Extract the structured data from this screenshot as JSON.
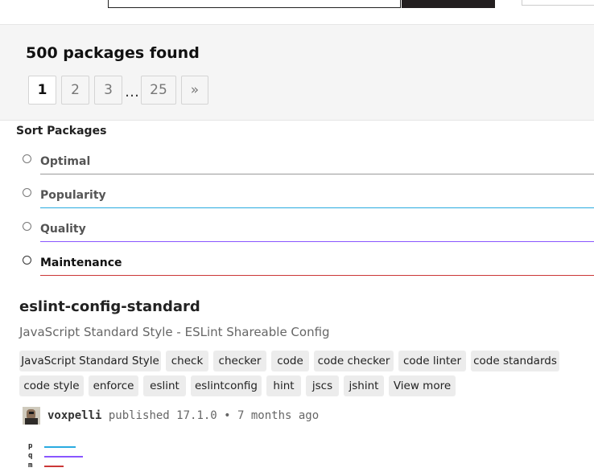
{
  "results": {
    "count_text": "500 packages found"
  },
  "pagination": {
    "pages": [
      "1",
      "2",
      "3",
      "25"
    ],
    "ellipsis": "…",
    "next": "»",
    "current": "1"
  },
  "sort": {
    "title": "Sort Packages",
    "options": [
      {
        "label": "Optimal",
        "color": "#999999",
        "selected": false
      },
      {
        "label": "Popularity",
        "color": "#29abe0",
        "selected": false
      },
      {
        "label": "Quality",
        "color": "#8956ff",
        "selected": false
      },
      {
        "label": "Maintenance",
        "color": "#cb3837",
        "selected": true
      }
    ]
  },
  "package": {
    "name": "eslint-config-standard",
    "description": "JavaScript Standard Style - ESLint Shareable Config",
    "keywords": [
      "JavaScript Standard Style",
      "check",
      "checker",
      "code",
      "code checker",
      "code linter",
      "code standards",
      "code style",
      "enforce",
      "eslint",
      "eslintconfig",
      "hint",
      "jscs",
      "jshint"
    ],
    "view_more": "View more",
    "publisher": "voxpelli",
    "published_text": "published 17.1.0 • 7 months ago",
    "scores": [
      {
        "letter": "p",
        "value": 0.39,
        "color": "#29abe0"
      },
      {
        "letter": "q",
        "value": 0.48,
        "color": "#8956ff"
      },
      {
        "letter": "m",
        "value": 0.24,
        "color": "#cb3837"
      }
    ]
  }
}
